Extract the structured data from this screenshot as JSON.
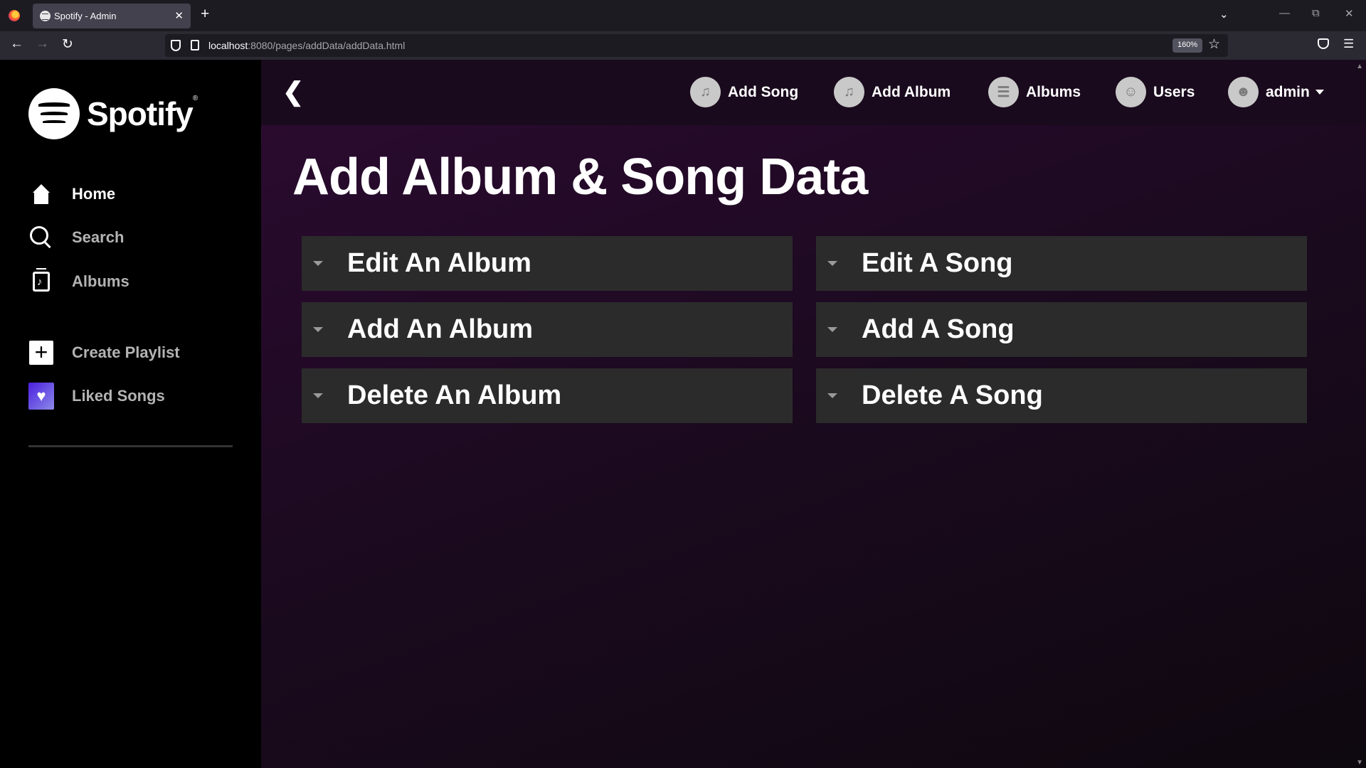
{
  "browser": {
    "tab_title": "Spotify - Admin",
    "tab_close": "✕",
    "new_tab": "+",
    "url_host": "localhost",
    "url_rest": ":8080/pages/addData/addData.html",
    "zoom": "160%"
  },
  "sidebar": {
    "brand": "Spotify",
    "brand_mark": "®",
    "nav": [
      {
        "label": "Home",
        "icon": "home-icon"
      },
      {
        "label": "Search",
        "icon": "search-icon"
      },
      {
        "label": "Albums",
        "icon": "albums-icon"
      }
    ],
    "library": [
      {
        "label": "Create Playlist",
        "icon": "plus-icon"
      },
      {
        "label": "Liked Songs",
        "icon": "heart-icon"
      }
    ]
  },
  "topbar": {
    "back": "❮",
    "links": [
      {
        "label": "Add Song",
        "icon": "add-song-icon"
      },
      {
        "label": "Add Album",
        "icon": "add-album-icon"
      },
      {
        "label": "Albums",
        "icon": "albums-list-icon"
      },
      {
        "label": "Users",
        "icon": "users-icon"
      }
    ],
    "user": "admin"
  },
  "main": {
    "title": "Add Album & Song Data",
    "album_panels": [
      "Edit An Album",
      "Add An Album",
      "Delete An Album"
    ],
    "song_panels": [
      "Edit A Song",
      "Add A Song",
      "Delete A Song"
    ]
  }
}
